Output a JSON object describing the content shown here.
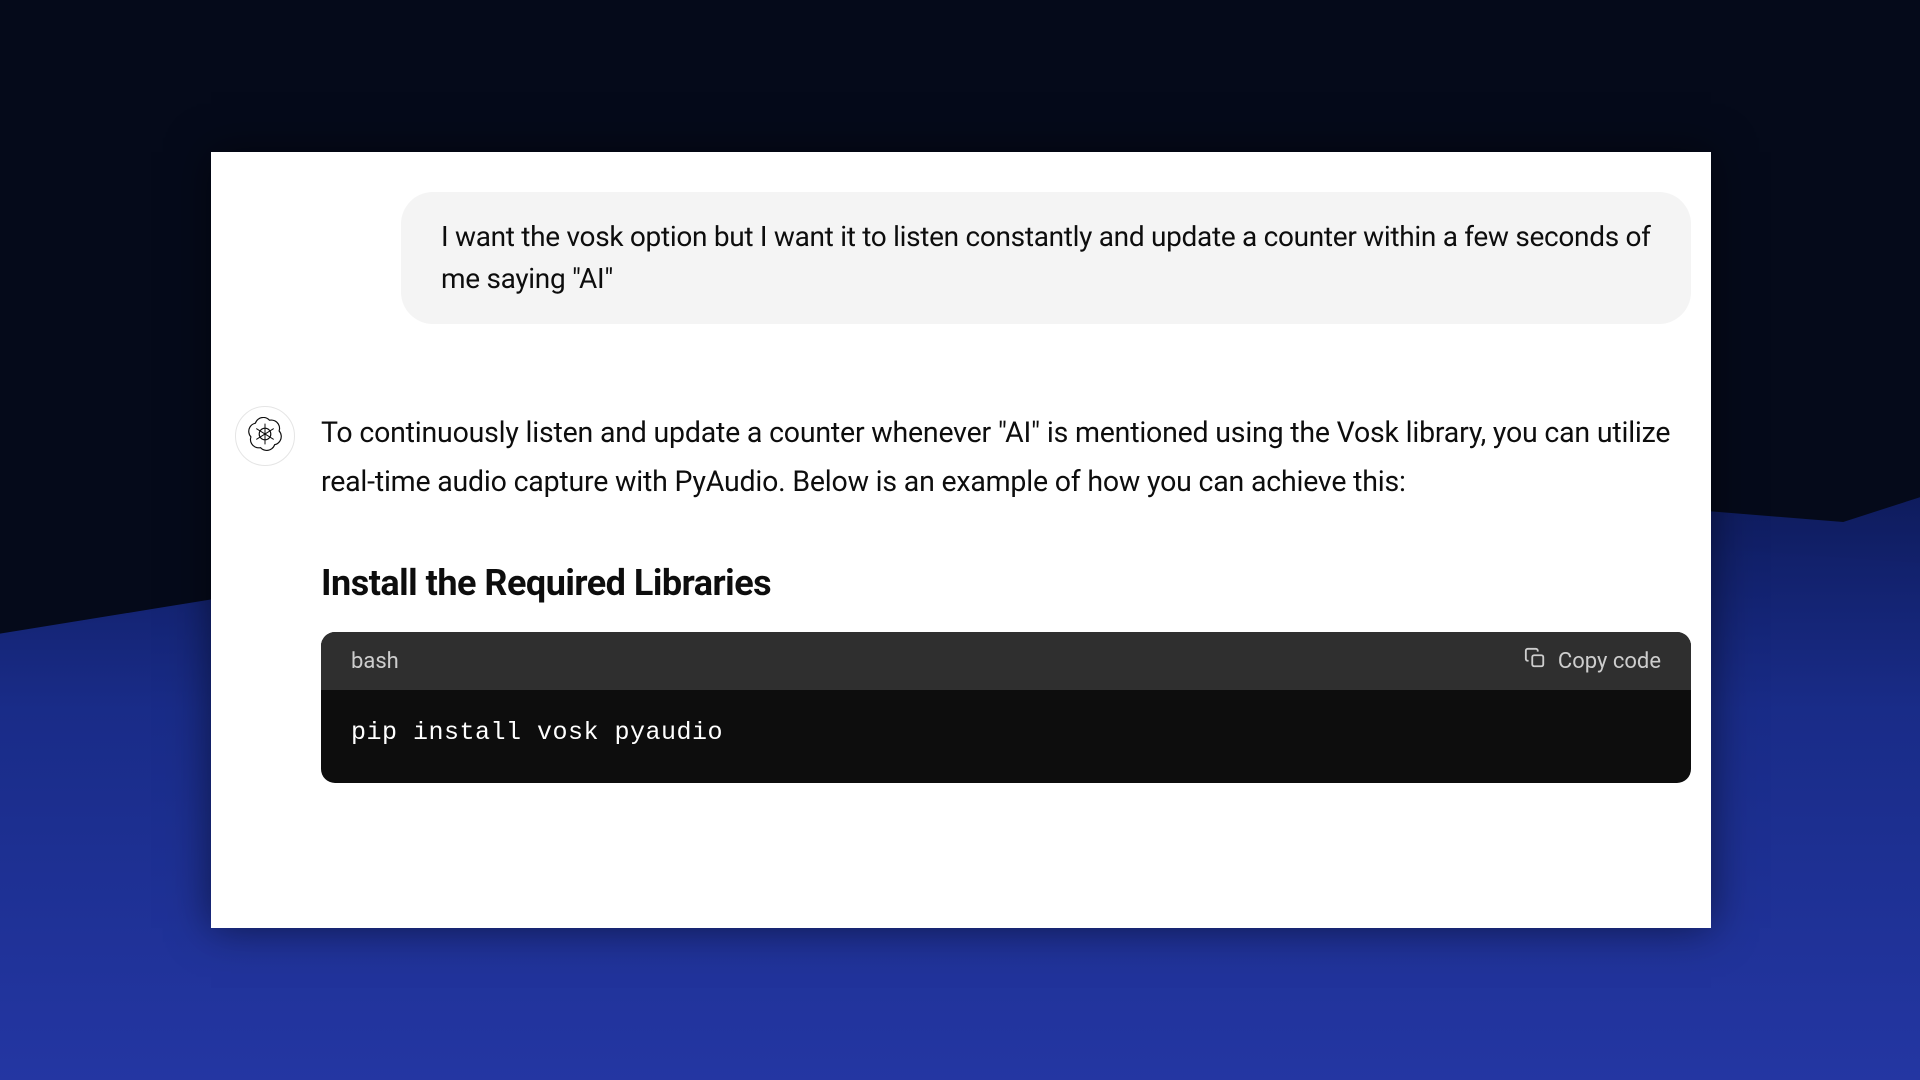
{
  "user_message": "I want the vosk option but I want it to listen constantly and update a counter within a few seconds of me saying \"AI\"",
  "assistant": {
    "intro_text": "To continuously listen and update a counter whenever \"AI\" is mentioned using the Vosk library, you can utilize real-time audio capture with PyAudio. Below is an example of how you can achieve this:",
    "section_heading": "Install the Required Libraries",
    "code_block": {
      "language": "bash",
      "copy_label": "Copy code",
      "code": "pip install vosk pyaudio"
    }
  }
}
